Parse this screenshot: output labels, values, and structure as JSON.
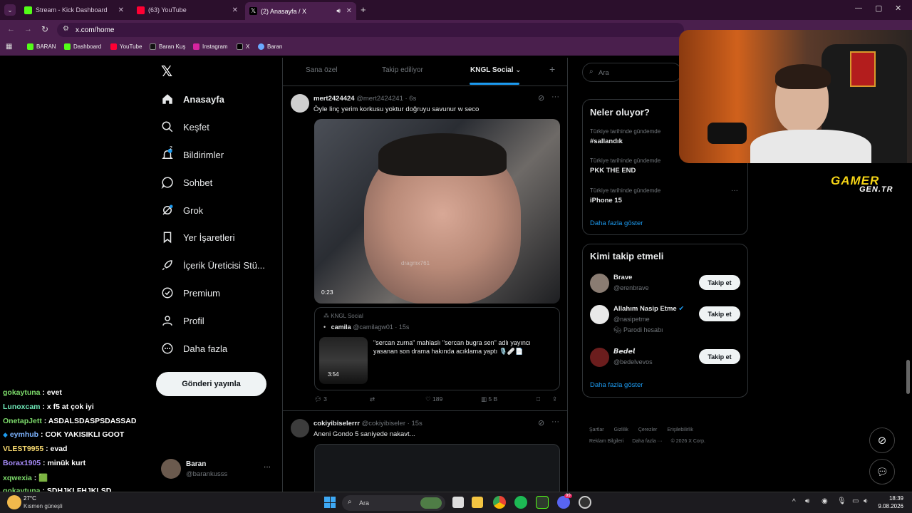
{
  "browser": {
    "tabs": [
      {
        "title": "Stream - Kick Dashboard",
        "icon_color": "#53fc18"
      },
      {
        "title": "(63) YouTube",
        "icon_color": "#ff0033"
      },
      {
        "title": "(2) Anasayfa / X",
        "icon_color": "#ffffff"
      }
    ],
    "url": "x.com/home",
    "bookmarks": [
      "BARAN",
      "Dashboard",
      "YouTube",
      "Baran Kuş",
      "Instagram",
      "X",
      "Baran"
    ]
  },
  "sidebar": {
    "items": [
      "Anasayfa",
      "Keşfet",
      "Bildirimler",
      "Sohbet",
      "Grok",
      "Yer İşaretleri",
      "İçerik Üreticisi Stü...",
      "Premium",
      "Profil",
      "Daha fazla"
    ],
    "notif_badge": "2",
    "post_button": "Gönderi yayınla",
    "account_name": "Baran",
    "account_handle": "@barankusss",
    "more": "···"
  },
  "feed": {
    "tabs": [
      "Sana özel",
      "Takip ediliyor",
      "KNGL Social"
    ],
    "plus": "+",
    "post1": {
      "name": "mert2424424",
      "handle": "@mert2424241",
      "time": "· 6s",
      "text": "Öyle linç yerim korkusu yoktur doğruyu savunur w seco",
      "video_time": "0:23",
      "watermark": "dragmx761",
      "quote": {
        "community": "KNGL Social",
        "name": "camila",
        "handle": "@camilagw01",
        "time": "· 15s",
        "text": "\"sercan zurna\" mahlaslı \"sercan bugra sen\" adlı yayıncı yasanan son drama hakında acıklama yaptı 🎙️🩹📄",
        "thumb_time": "3:54"
      },
      "stats": {
        "replies": "3",
        "likes": "189",
        "views": "5 B"
      }
    },
    "post2": {
      "name": "cokiyibiselerrr",
      "handle": "@cokiyibiseler",
      "time": "· 15s",
      "text": "Aneni Gondo 5 saniyede nakavt..."
    }
  },
  "right": {
    "search_placeholder": "Ara",
    "trends_title": "Neler oluyor?",
    "trends": [
      {
        "sub": "Türkiye tarihinde gündemde",
        "name": "#sallandık"
      },
      {
        "sub": "Türkiye tarihinde gündemde",
        "name": "PKK THE END"
      },
      {
        "sub": "Türkiye tarihinde gündemde",
        "name": "iPhone 15"
      }
    ],
    "show_more": "Daha fazla göster",
    "follow_title": "Kimi takip etmeli",
    "follow": [
      {
        "name": "Brave",
        "handle": "@erenbrave",
        "extra": ""
      },
      {
        "name": "Allahım Nasip Etme",
        "handle": "@nasipetme",
        "extra": "Parodi hesabı"
      },
      {
        "name": "𝘽𝙚𝙙𝙚𝙡",
        "handle": "@bedelvevos",
        "extra": ""
      }
    ],
    "follow_btn": "Takip et",
    "footer1": [
      "Şartlar",
      "Gizlilik",
      "Çerezler",
      "Erişilebilirlik"
    ],
    "footer2": [
      "Reklam Bilgileri",
      "Daha fazla ···",
      "© 2026 X Corp."
    ]
  },
  "overlay": {
    "brand_top": "GAMER",
    "brand_bottom": "GEN.TR"
  },
  "chat": [
    {
      "user": "gokaytuna",
      "msg": ": evet",
      "color": "#7ddc6b"
    },
    {
      "user": "Lunoxcam",
      "msg": ": x f5 at çok iyi",
      "color": "#6ee7b7"
    },
    {
      "user": "OnetapJett",
      "msg": ": ASDALSDASPSDASSAD",
      "color": "#7ddc6b"
    },
    {
      "user": "eymhub",
      "msg": ": COK YAKISIKLI GOOT",
      "color": "#7db3ff"
    },
    {
      "user": "VLEST9955",
      "msg": ": evad",
      "color": "#f5d76e"
    },
    {
      "user": "Borax1905",
      "msg": ": minük kurt",
      "color": "#a78bfa"
    },
    {
      "user": "xqwexia",
      "msg": ": 🟩",
      "color": "#7ddc6b"
    },
    {
      "user": "gokaytuna",
      "msg": ": SDHJKLFHJKLSD",
      "color": "#7ddc6b"
    }
  ],
  "taskbar": {
    "weather_temp": "27°C",
    "weather_text": "Kısmen güneşli",
    "search": "Ara",
    "time": "18:39",
    "date": "9.08.2026",
    "discord_badge": "99"
  }
}
